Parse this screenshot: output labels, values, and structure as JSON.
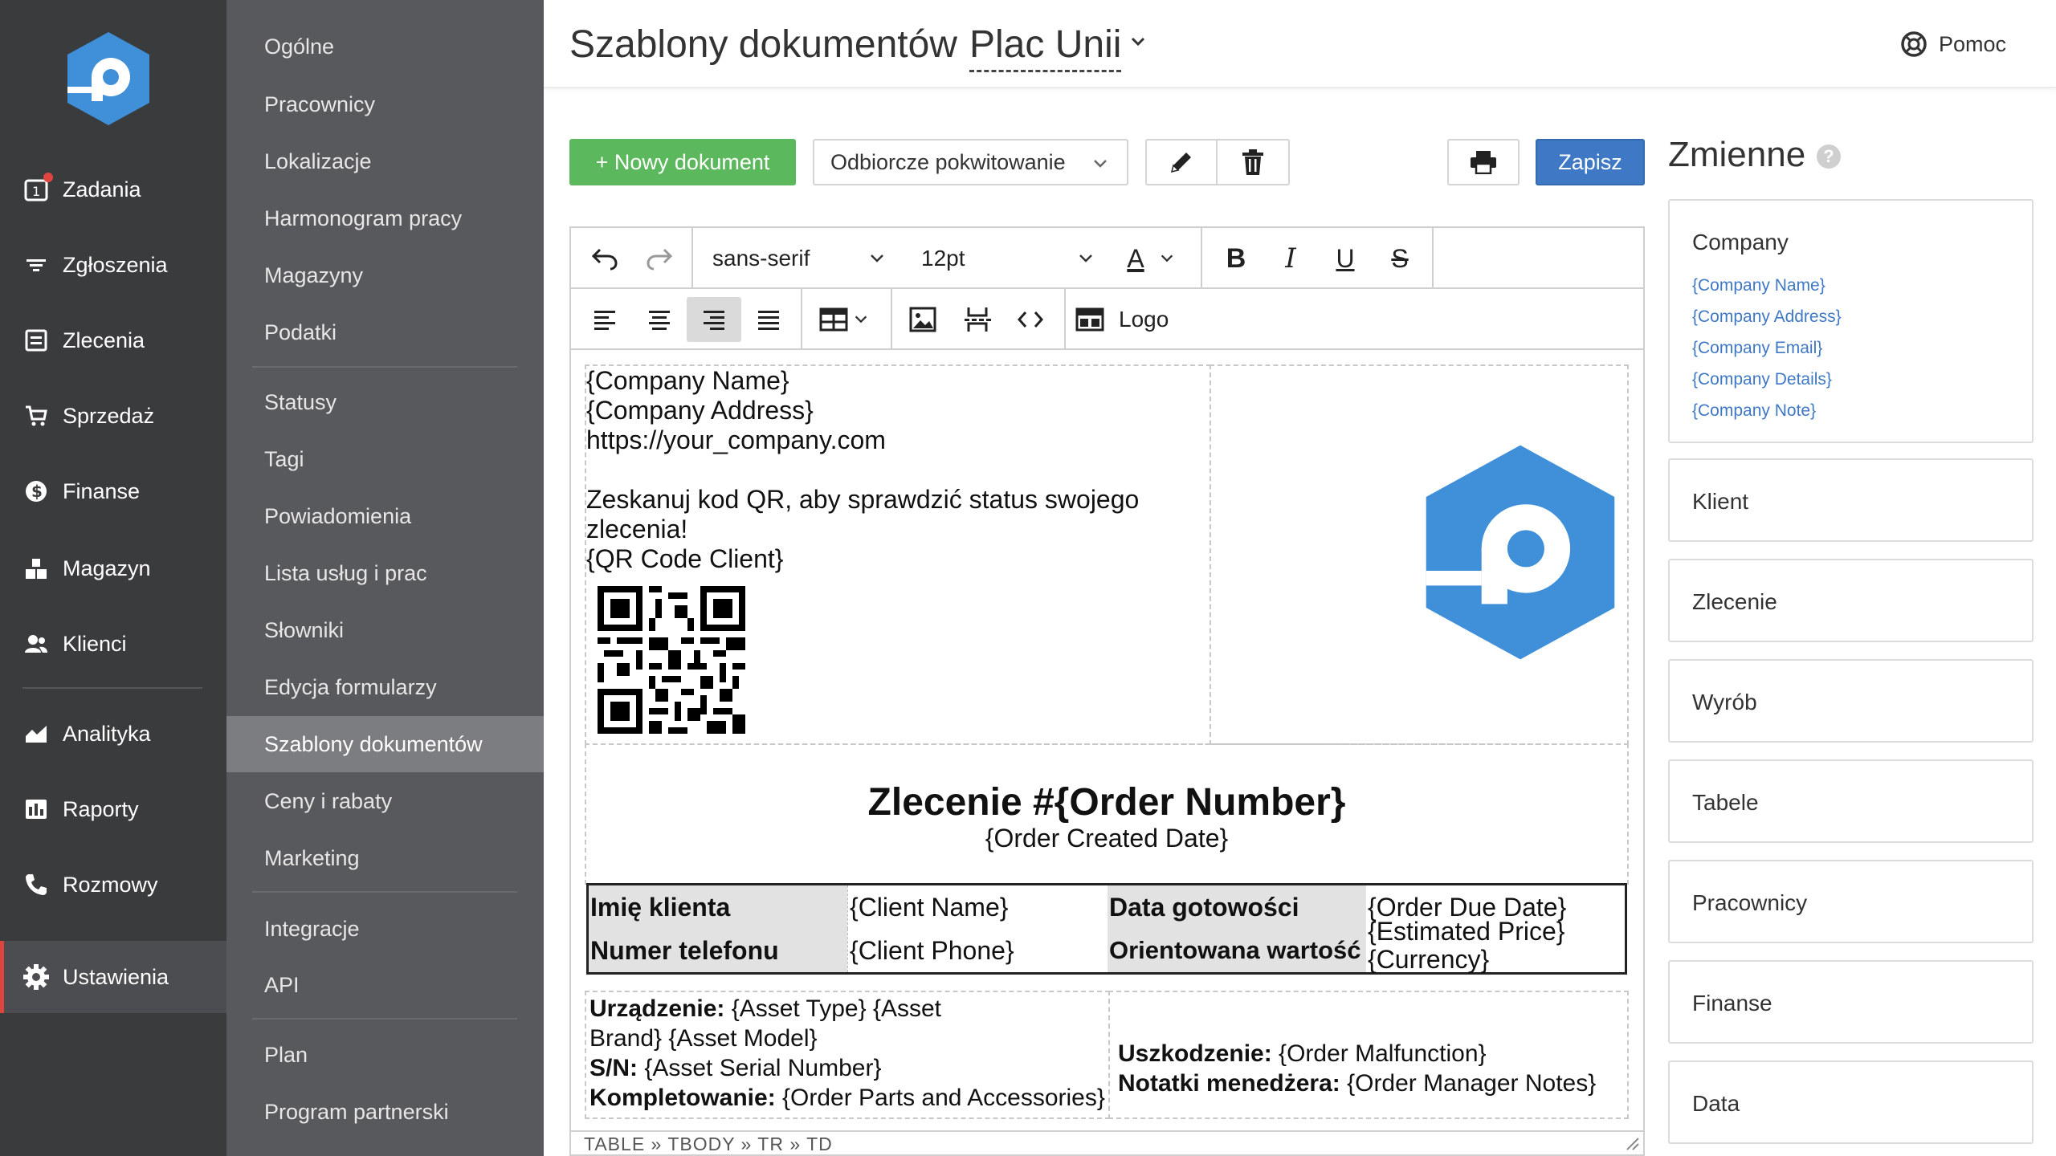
{
  "nav": {
    "items": [
      {
        "label": "Zadania",
        "icon": "tasks-icon",
        "badge": true
      },
      {
        "label": "Zgłoszenia",
        "icon": "filter-icon"
      },
      {
        "label": "Zlecenia",
        "icon": "orders-icon"
      },
      {
        "label": "Sprzedaż",
        "icon": "cart-icon"
      },
      {
        "label": "Finanse",
        "icon": "dollar-icon"
      },
      {
        "label": "Magazyn",
        "icon": "warehouse-icon"
      },
      {
        "label": "Klienci",
        "icon": "users-icon"
      },
      {
        "label": "Analityka",
        "icon": "analytics-icon"
      },
      {
        "label": "Raporty",
        "icon": "reports-icon"
      },
      {
        "label": "Rozmowy",
        "icon": "phone-icon"
      },
      {
        "label": "Ustawienia",
        "icon": "gear-icon",
        "active": true
      }
    ]
  },
  "submenu": {
    "items": [
      "Ogólne",
      "Pracownicy",
      "Lokalizacje",
      "Harmonogram pracy",
      "Magazyny",
      "Podatki",
      "Statusy",
      "Tagi",
      "Powiadomienia",
      "Lista usług i prac",
      "Słowniki",
      "Edycja formularzy",
      "Szablony dokumentów",
      "Ceny i rabaty",
      "Marketing",
      "Integracje",
      "API",
      "Plan",
      "Program partnerski"
    ],
    "active": "Szablony dokumentów"
  },
  "header": {
    "title": "Szablony dokumentów",
    "location": "Plac Unii",
    "help": "Pomoc"
  },
  "toolbar": {
    "new_doc": "+ Nowy dokument",
    "selected_template": "Odbiorcze pokwitowanie",
    "save": "Zapisz"
  },
  "editor": {
    "font_family": "sans-serif",
    "font_size": "12pt",
    "font_color_letter": "A",
    "logo_label": "Logo",
    "status_path": "TABLE » TBODY » TR » TD"
  },
  "document": {
    "company_lines": [
      "{Company Name}",
      "{Company Address}",
      "https://your_company.com"
    ],
    "qr_lines": [
      "Zeskanuj kod QR, aby sprawdzić status swojego",
      "zlecenia!",
      "{QR Code Client}"
    ],
    "order_title": "Zlecenie #{Order Number}",
    "order_date": "{Order Created Date}",
    "info": {
      "client_name_label": "Imię klienta",
      "client_name_value": "{Client Name}",
      "due_date_label": "Data gotowości",
      "due_date_value": "{Order Due Date}",
      "phone_label": "Numer telefonu",
      "phone_value": "{Client Phone}",
      "price_label": "Orientowana wartość",
      "price_value_1": "{Estimated Price}",
      "price_value_2": "{Currency}"
    },
    "asset": {
      "device_label": "Urządzenie:",
      "device_value_1": " {Asset Type} {Asset",
      "device_value_2": "Brand} {Asset Model}",
      "sn_label": "S/N:",
      "sn_value": " {Asset Serial Number}",
      "kit_label": "Kompletowanie:",
      "kit_value": " {Order Parts and Accessories}",
      "damage_label": "Uszkodzenie:",
      "damage_value": " {Order Malfunction}",
      "notes_label": "Notatki menedżera:",
      "notes_value": " {Order Manager Notes}"
    }
  },
  "variables": {
    "title": "Zmienne",
    "help": "?",
    "company": {
      "title": "Company",
      "links": [
        "{Company Name}",
        "{Company Address}",
        "{Company Email}",
        "{Company Details}",
        "{Company Note}"
      ]
    },
    "groups": [
      "Klient",
      "Zlecenie",
      "Wyrób",
      "Tabele",
      "Pracownicy",
      "Finanse",
      "Data"
    ]
  },
  "colors": {
    "brand_blue": "#3f8fd9",
    "save_blue": "#3f78c5",
    "new_green": "#5cb85c",
    "nav_bg": "#3a3b3d",
    "submenu_bg": "#58595c",
    "accent_red": "#e0443e"
  }
}
